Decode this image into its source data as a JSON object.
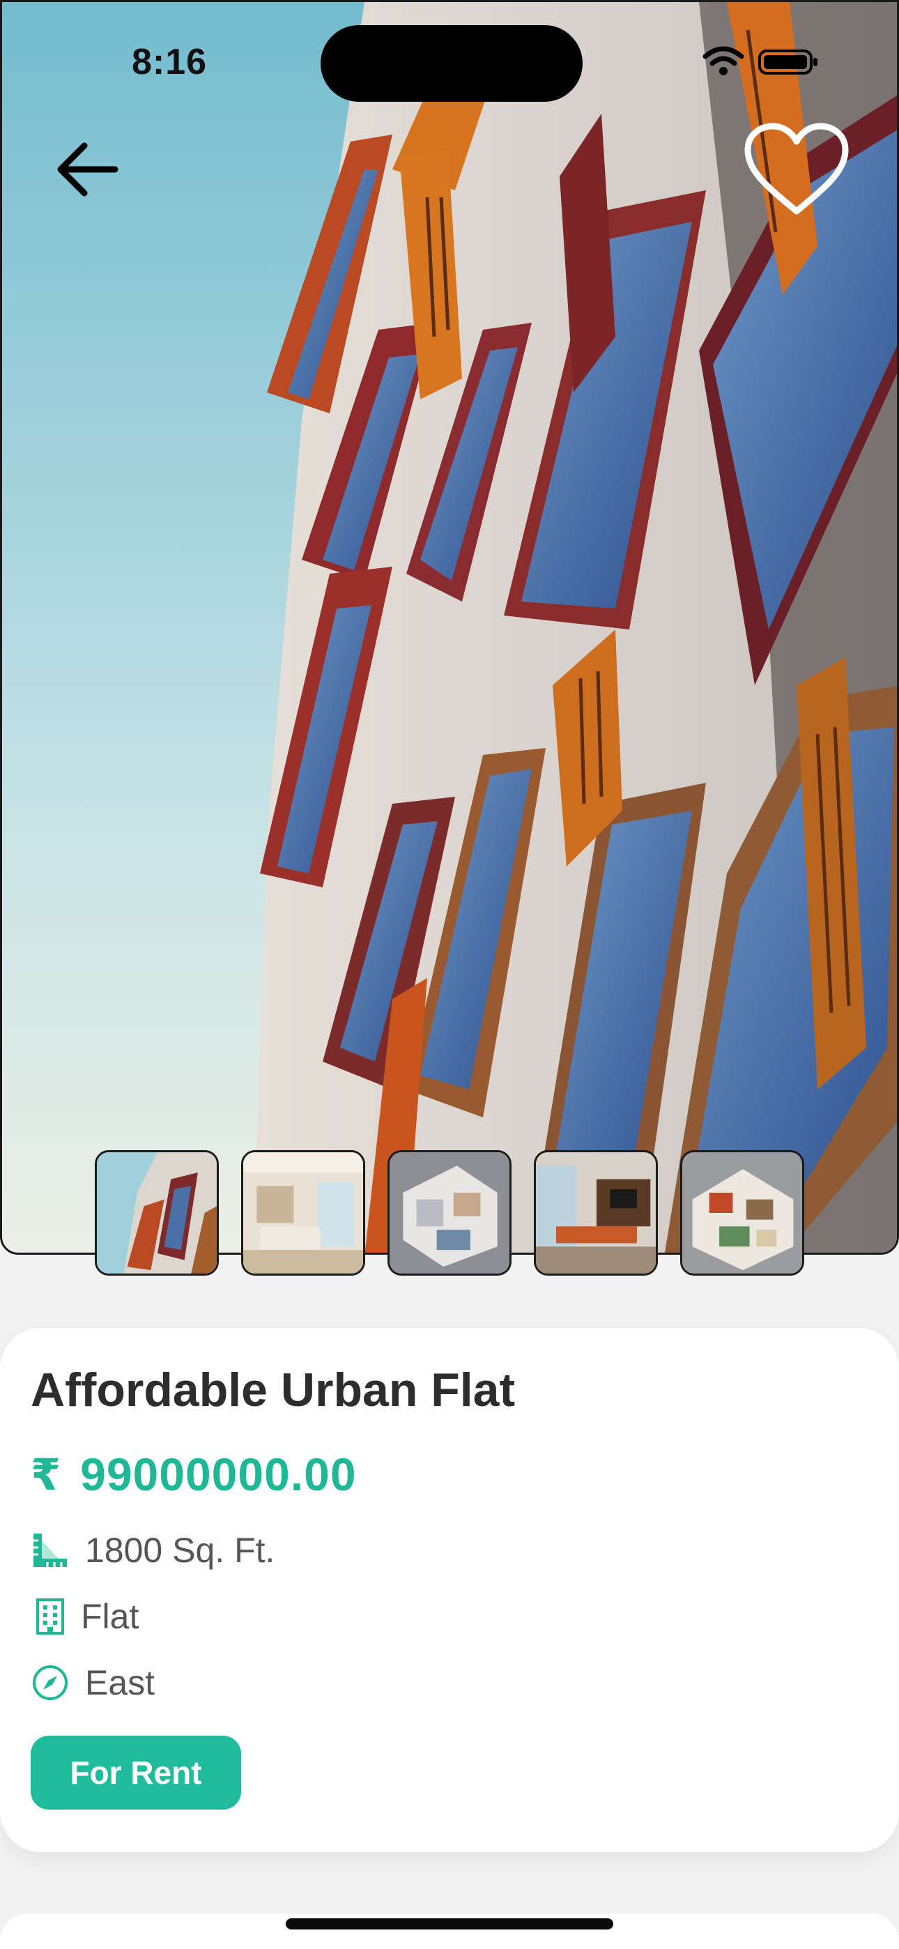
{
  "status_bar": {
    "time": "8:16"
  },
  "gallery": {
    "thumbnails": [
      {
        "name": "building exterior"
      },
      {
        "name": "living room"
      },
      {
        "name": "3d floor plan"
      },
      {
        "name": "dining area"
      },
      {
        "name": "furnished floor plan"
      }
    ]
  },
  "property": {
    "title": "Affordable Urban Flat",
    "currency_symbol": "₹",
    "price": "99000000.00",
    "area": "1800 Sq. Ft.",
    "type": "Flat",
    "facing": "East",
    "listing_type": "For Rent"
  },
  "icons": {
    "back": "arrow-left-icon",
    "favorite": "heart-outline-icon",
    "area": "ruler-icon",
    "type": "building-icon",
    "facing": "compass-icon"
  },
  "colors": {
    "accent": "#1fb896",
    "button": "#1fbc9b",
    "title": "#2d2d2d"
  }
}
